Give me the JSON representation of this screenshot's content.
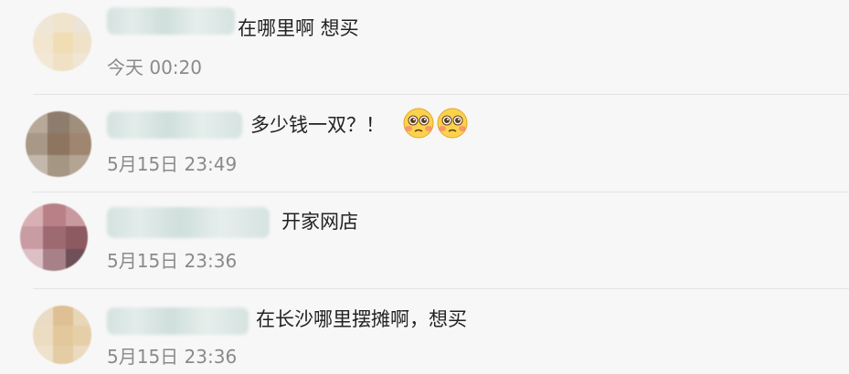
{
  "comments": [
    {
      "text": "在哪里啊 想买",
      "time": "今天 00:20"
    },
    {
      "text": "多少钱一双？！",
      "time": "5月15日 23:49",
      "emojis": [
        "pleading-face-icon",
        "pleading-face-icon"
      ]
    },
    {
      "text": "开家网店",
      "time": "5月15日 23:36"
    },
    {
      "text": "在长沙哪里摆摊啊，想买",
      "time": "5月15日 23:36"
    }
  ]
}
